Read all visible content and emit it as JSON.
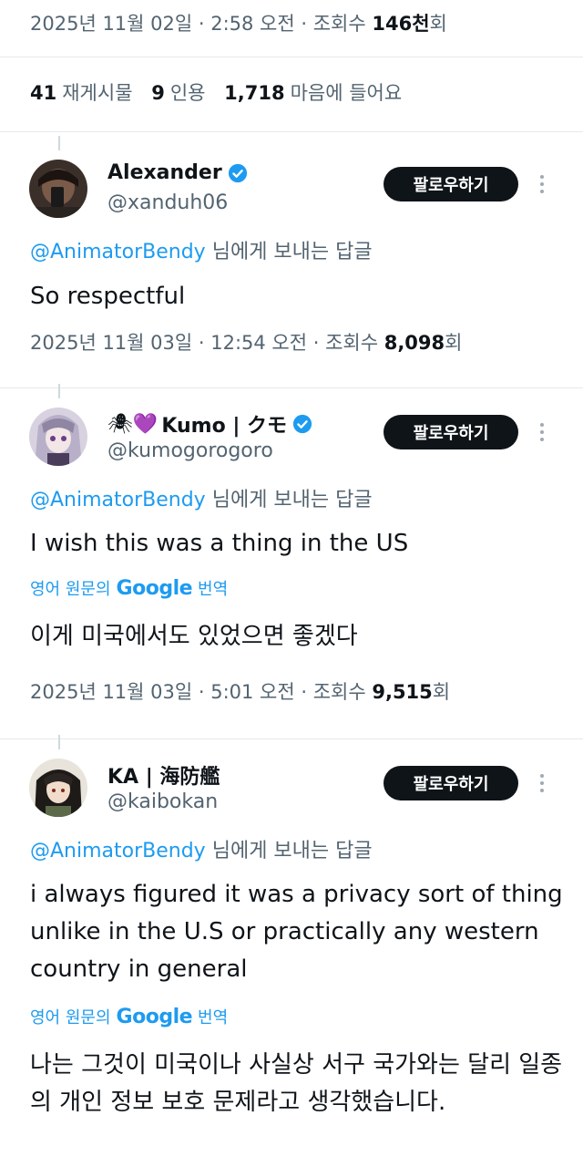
{
  "main_tweet": {
    "meta_prefix": "2025년 11월 02일 · 2:58 오전 · 조회수 ",
    "meta_views": "146천",
    "meta_suffix": "회",
    "stats": [
      {
        "value": "41",
        "label": "재게시물"
      },
      {
        "value": "9",
        "label": "인용"
      },
      {
        "value": "1,718",
        "label": "마음에 들어요"
      }
    ]
  },
  "follow_label": "팔로우하기",
  "replies": [
    {
      "name": "Alexander",
      "emoji": "",
      "verified": true,
      "handle": "@xanduh06",
      "reply_mention": "@AnimatorBendy",
      "reply_suffix": " 님에게 보내는 답글",
      "text": "So respectful",
      "meta_prefix": "2025년 11월 03일 · 12:54 오전 · 조회수 ",
      "meta_views": "8,098",
      "meta_suffix": "회"
    },
    {
      "name": "Kumo | クモ",
      "emoji": "🕷💜",
      "verified": true,
      "handle": "@kumogorogoro",
      "reply_mention": "@AnimatorBendy",
      "reply_suffix": " 님에게 보내는 답글",
      "text": "I wish this was a thing in the US",
      "translate_prefix": "영어 원문의",
      "translate_google": "Google",
      "translate_suffix": "번역",
      "translated_text": "이게 미국에서도 있었으면 좋겠다",
      "meta_prefix": "2025년 11월 03일 · 5:01 오전 · 조회수 ",
      "meta_views": "9,515",
      "meta_suffix": "회"
    },
    {
      "name": "KA | 海防艦",
      "emoji": "",
      "verified": false,
      "handle": "@kaibokan",
      "reply_mention": "@AnimatorBendy",
      "reply_suffix": " 님에게 보내는 답글",
      "text": "i always figured it was a privacy sort of thing unlike in the U.S or practically any western country in general",
      "translate_prefix": "영어 원문의",
      "translate_google": "Google",
      "translate_suffix": "번역",
      "translated_text": "나는 그것이 미국이나 사실상 서구 국가와는 달리 일종의 개인 정보 보호 문제라고 생각했습니다."
    }
  ],
  "colors": {
    "accent": "#1d9bf0",
    "text": "#0f1419",
    "muted": "#536471",
    "button_bg": "#0f1419"
  },
  "icons": [
    "verified-badge-icon",
    "more-options-icon",
    "google-logo"
  ]
}
